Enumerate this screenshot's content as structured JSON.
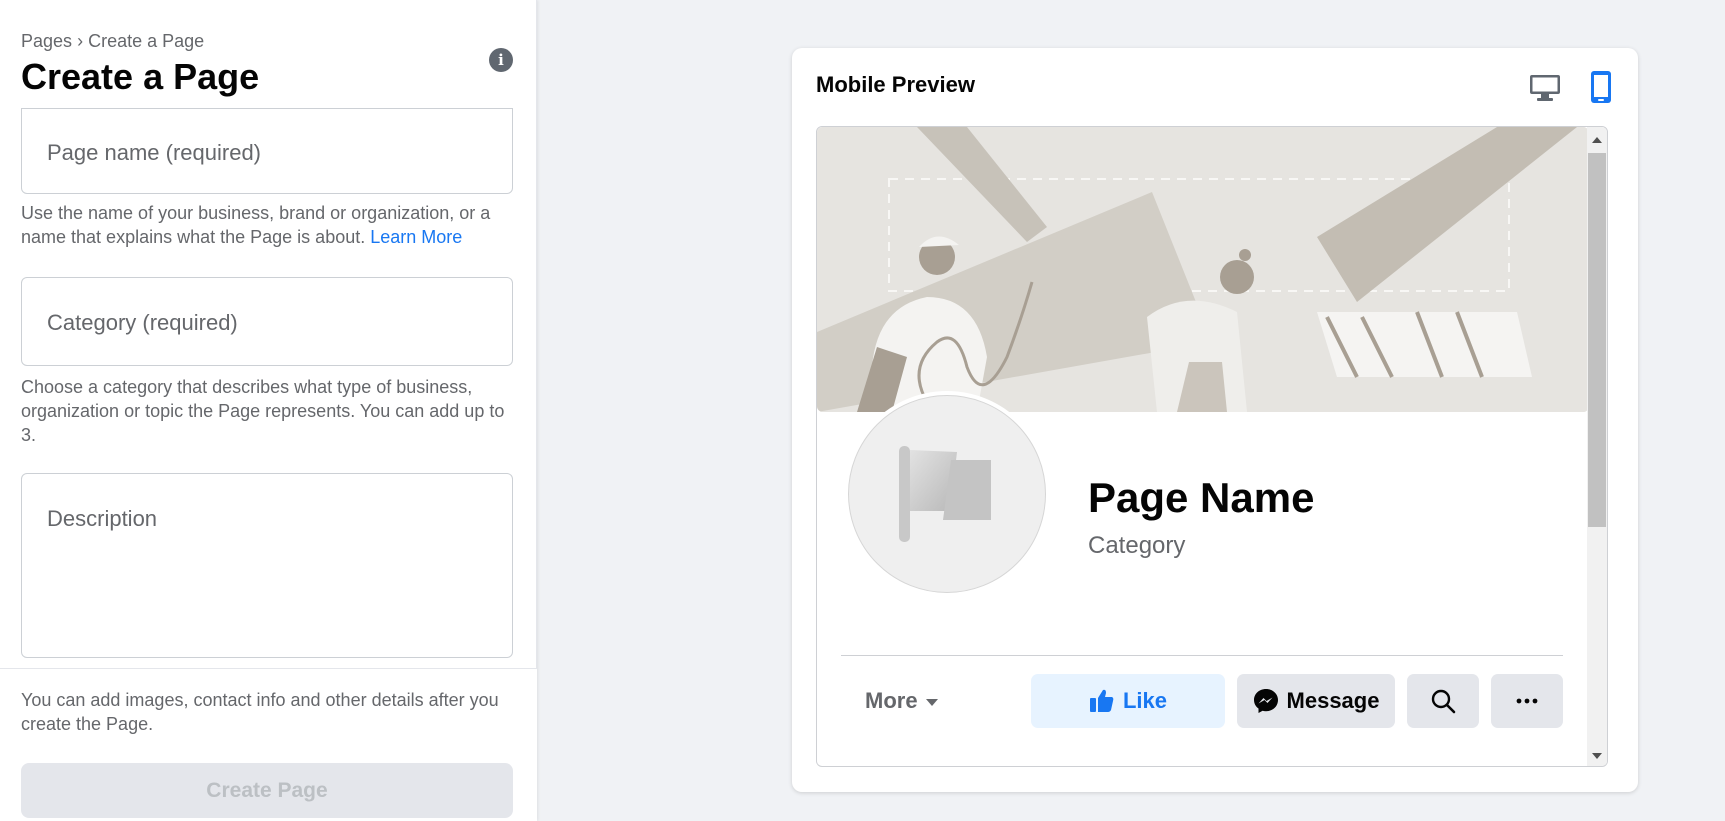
{
  "breadcrumb": {
    "root": "Pages",
    "separator": "›",
    "current": "Create a Page"
  },
  "page_title": "Create a Page",
  "form": {
    "name_placeholder": "Page name (required)",
    "name_help": "Use the name of your business, brand or organization, or a name that explains what the Page is about.",
    "learn_more": "Learn More",
    "category_placeholder": "Category (required)",
    "category_help": "Choose a category that describes what type of business, organization or topic the Page represents. You can add up to 3.",
    "description_placeholder": "Description"
  },
  "footer": {
    "note": "You can add images, contact info and other details after you create the Page.",
    "create_button": "Create Page"
  },
  "preview": {
    "title": "Mobile Preview",
    "page_name": "Page Name",
    "category": "Category",
    "more_label": "More",
    "like_label": "Like",
    "message_label": "Message",
    "colors": {
      "accent": "#1877f2",
      "like_bg": "#e7f3ff",
      "button_bg": "#e4e6eb"
    }
  }
}
